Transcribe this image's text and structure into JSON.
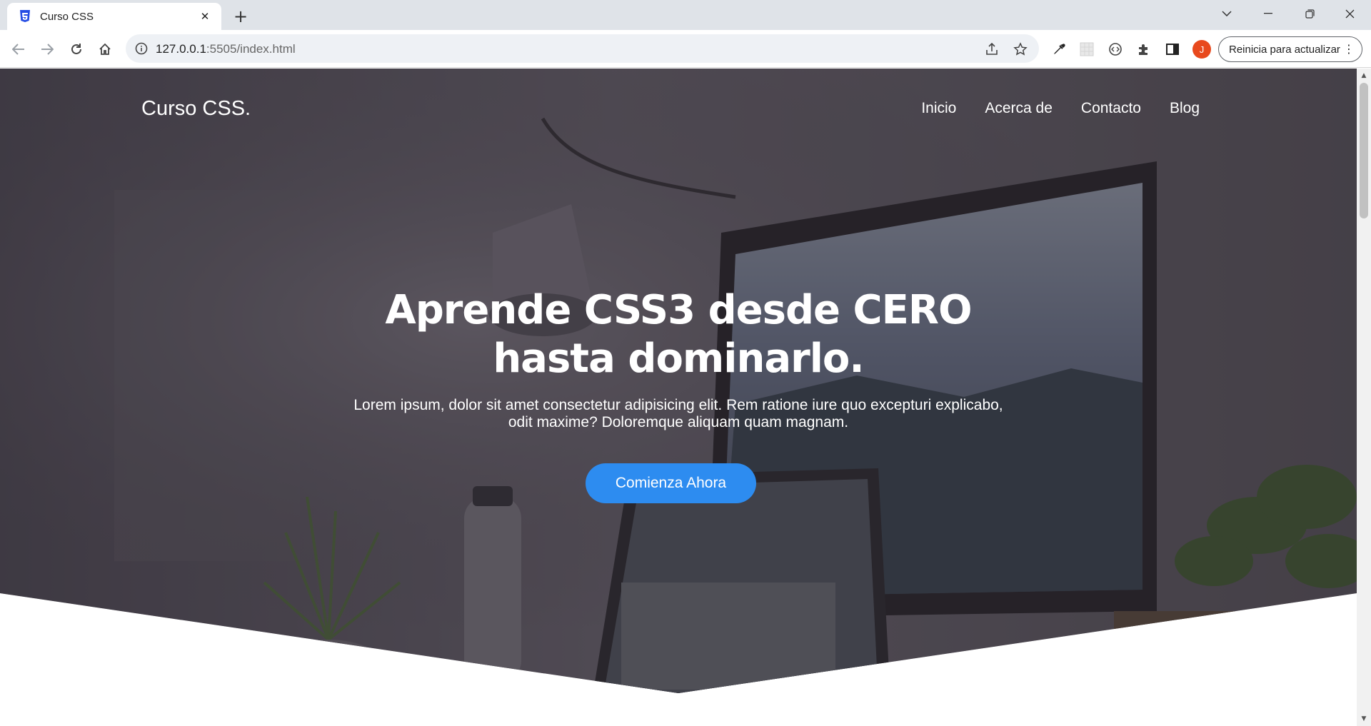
{
  "browser": {
    "tab": {
      "title": "Curso CSS"
    },
    "address": {
      "host": "127.0.0.1",
      "rest": ":5505/index.html"
    },
    "profile_initial": "J",
    "update_button": "Reinicia para actualizar"
  },
  "site": {
    "logo": "Curso CSS.",
    "nav": [
      {
        "label": "Inicio"
      },
      {
        "label": "Acerca de"
      },
      {
        "label": "Contacto"
      },
      {
        "label": "Blog"
      }
    ],
    "hero": {
      "title_line1": "Aprende CSS3 desde CERO",
      "title_line2": "hasta dominarlo.",
      "desc_line1": "Lorem ipsum, dolor sit amet consectetur adipisicing elit. Rem ratione iure quo excepturi explicabo,",
      "desc_line2": "odit maxime? Doloremque aliquam quam magnam.",
      "cta": "Comienza Ahora"
    }
  },
  "colors": {
    "accent": "#2d8cf0",
    "overlay": "#3f3a42",
    "tabbar": "#dfe3e8",
    "profile": "#e8491d"
  }
}
